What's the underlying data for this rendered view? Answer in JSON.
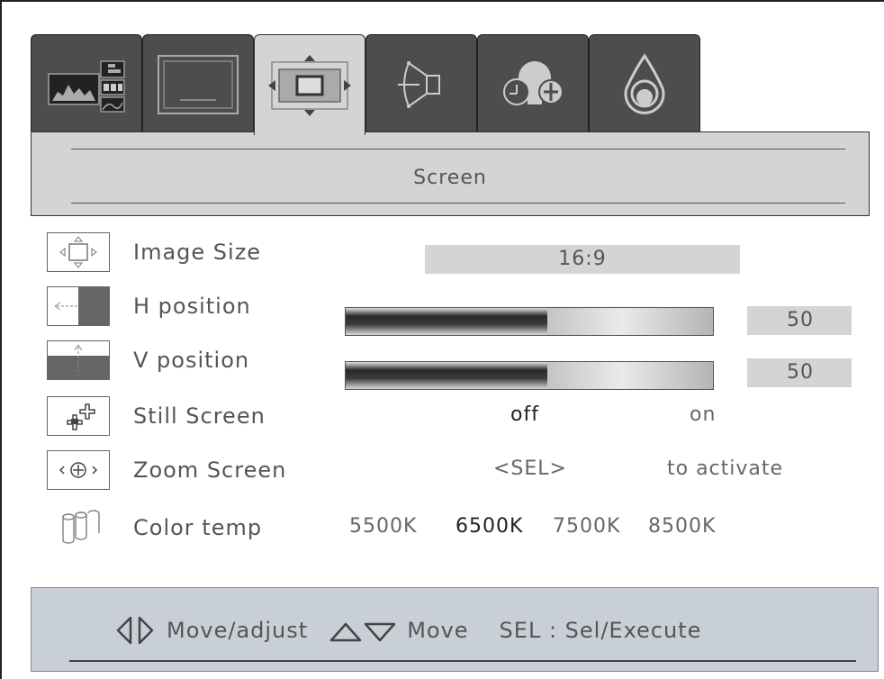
{
  "tabs": [
    {
      "icon": "picture-settings-icon",
      "active": false
    },
    {
      "icon": "display-icon",
      "active": false
    },
    {
      "icon": "screen-position-icon",
      "active": true
    },
    {
      "icon": "audio-speaker-icon",
      "active": false
    },
    {
      "icon": "lamp-settings-icon",
      "active": false
    },
    {
      "icon": "color-drop-icon",
      "active": false
    }
  ],
  "header": {
    "title": "Screen"
  },
  "rows": [
    {
      "key": "image_size",
      "icon": "image-size-icon",
      "label": "Image Size",
      "value": "16:9"
    },
    {
      "key": "h_position",
      "icon": "h-position-icon",
      "label": "H position",
      "value": "50",
      "fill_percent": 55
    },
    {
      "key": "v_position",
      "icon": "v-position-icon",
      "label": "V position",
      "value": "50",
      "fill_percent": 55
    },
    {
      "key": "still_screen",
      "icon": "still-screen-icon",
      "label": "Still Screen",
      "options": [
        "off",
        "on"
      ],
      "selected": "off"
    },
    {
      "key": "zoom_screen",
      "icon": "zoom-icon",
      "label": "Zoom Screen",
      "text1": "<SEL>",
      "text2": "to activate"
    },
    {
      "key": "color_temp",
      "icon": "color-temp-icon",
      "label": "Color temp",
      "options": [
        "5500K",
        "6500K",
        "7500K",
        "8500K"
      ],
      "selected": "6500K"
    }
  ],
  "footer": {
    "adjust": "Move/adjust",
    "move": "Move",
    "sel": "SEL : Sel/Execute"
  },
  "colors": {
    "panel": "#d4d4d6",
    "tab_dark": "#4d4d4f",
    "footer": "#c9cfd6",
    "text": "#555555"
  }
}
